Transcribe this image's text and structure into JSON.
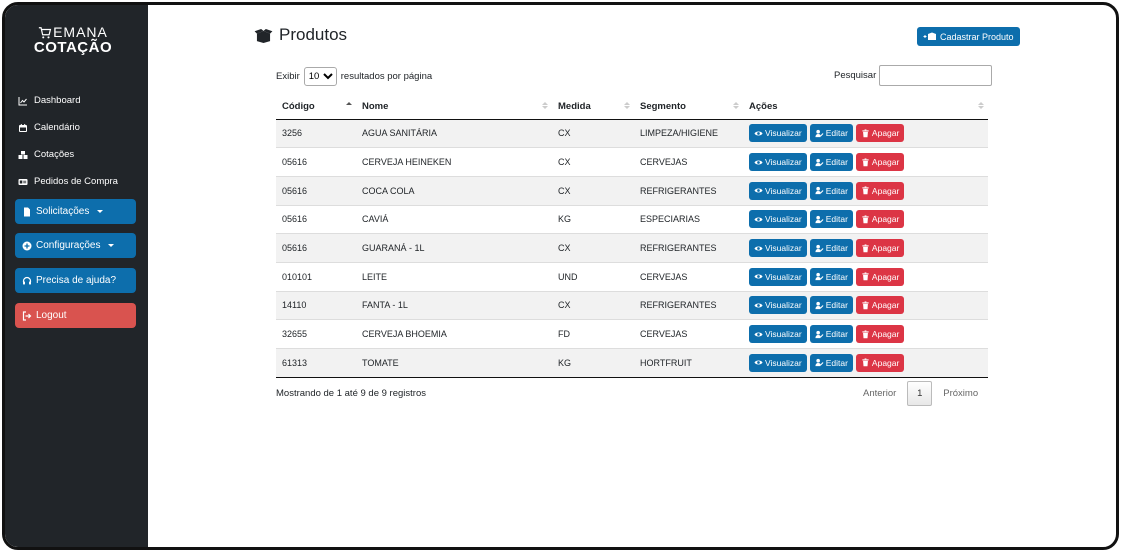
{
  "brand": {
    "line1": "EMANA",
    "line2": "COTAÇÃO"
  },
  "sidebar": {
    "links": [
      {
        "label": "Dashboard",
        "icon": "chart-line-icon"
      },
      {
        "label": "Calendário",
        "icon": "calendar-icon"
      },
      {
        "label": "Cotações",
        "icon": "boxes-icon"
      },
      {
        "label": "Pedidos de Compra",
        "icon": "id-card-icon"
      }
    ],
    "buttons": [
      {
        "label": "Solicitações",
        "icon": "file-icon",
        "dropdown": true
      },
      {
        "label": "Configurações",
        "icon": "plus-circle-icon",
        "dropdown": true
      },
      {
        "label": "Precisa de ajuda?",
        "icon": "headset-icon"
      },
      {
        "label": "Logout",
        "icon": "logout-icon"
      }
    ]
  },
  "page": {
    "title": "Produtos",
    "add_label": "Cadastrar Produto"
  },
  "table_controls": {
    "show_label": "Exibir",
    "length_value": "10",
    "length_suffix": "resultados por página",
    "search_label": "Pesquisar",
    "search_value": ""
  },
  "columns": [
    "Código",
    "Nome",
    "Medida",
    "Segmento",
    "Ações"
  ],
  "actions": {
    "view": "Visualizar",
    "edit": "Editar",
    "delete": "Apagar"
  },
  "rows": [
    [
      "3256",
      "AGUA SANITÁRIA",
      "CX",
      "LIMPEZA/HIGIENE"
    ],
    [
      "05616",
      "CERVEJA HEINEKEN",
      "CX",
      "CERVEJAS"
    ],
    [
      "05616",
      "COCA COLA",
      "CX",
      "REFRIGERANTES"
    ],
    [
      "05616",
      "CAVIÁ",
      "KG",
      "ESPECIARIAS"
    ],
    [
      "05616",
      "GUARANÁ - 1L",
      "CX",
      "REFRIGERANTES"
    ],
    [
      "010101",
      "LEITE",
      "UND",
      "CERVEJAS"
    ],
    [
      "14110",
      "FANTA - 1L",
      "CX",
      "REFRIGERANTES"
    ],
    [
      "32655",
      "CERVEJA BHOEMIA",
      "FD",
      "CERVEJAS"
    ],
    [
      "61313",
      "TOMATE",
      "KG",
      "HORTFRUIT"
    ]
  ],
  "footer": {
    "info": "Mostrando de 1 até 9 de 9 registros",
    "prev": "Anterior",
    "page": "1",
    "next": "Próximo"
  },
  "colors": {
    "sidebar": "#212529",
    "primary": "#0d6eac",
    "danger": "#dc3545",
    "logout": "#d9534f"
  }
}
